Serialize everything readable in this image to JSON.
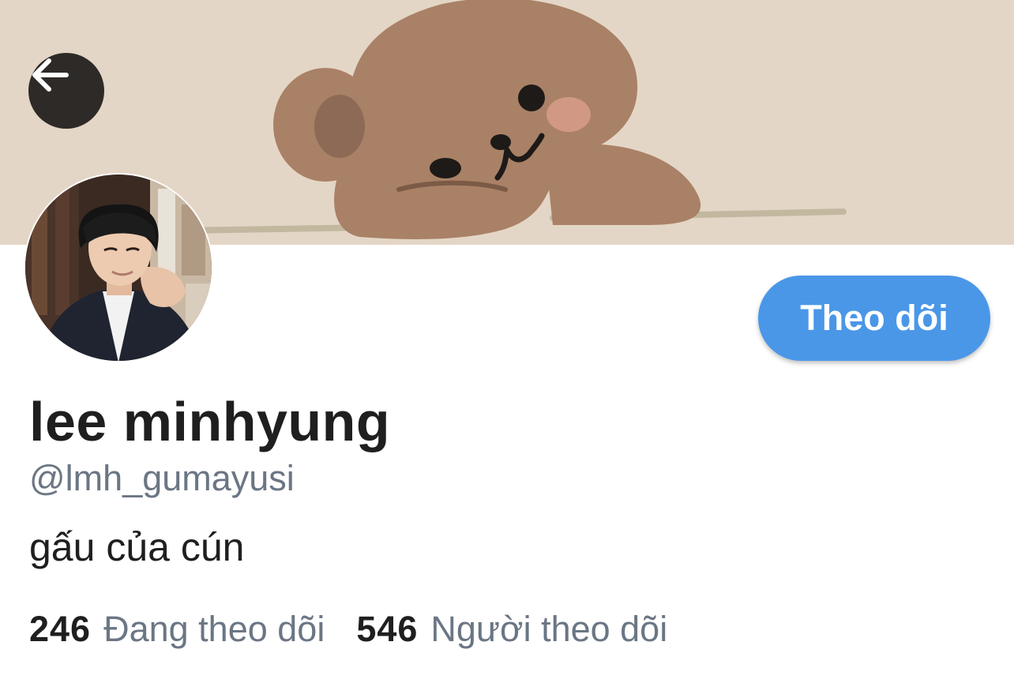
{
  "header": {
    "back_icon": "arrow-left-icon",
    "banner_image": "cartoon brown bear lying on ground",
    "colors": {
      "banner_bg": "#e4d6c6",
      "back_button_bg": "#2d2a27"
    }
  },
  "profile": {
    "display_name": "lee minhyung",
    "handle": "@lmh_gumayusi",
    "bio": "gấu của cún",
    "follow_button_label": "Theo dõi",
    "avatar": "profile photo of a man in dark jacket"
  },
  "stats": {
    "following_count": "246",
    "following_label": "Đang theo dõi",
    "followers_count": "546",
    "followers_label": "Người theo dõi"
  },
  "colors": {
    "accent": "#4a97e8",
    "text_primary": "#1f1f1f",
    "text_secondary": "#6b7684"
  }
}
